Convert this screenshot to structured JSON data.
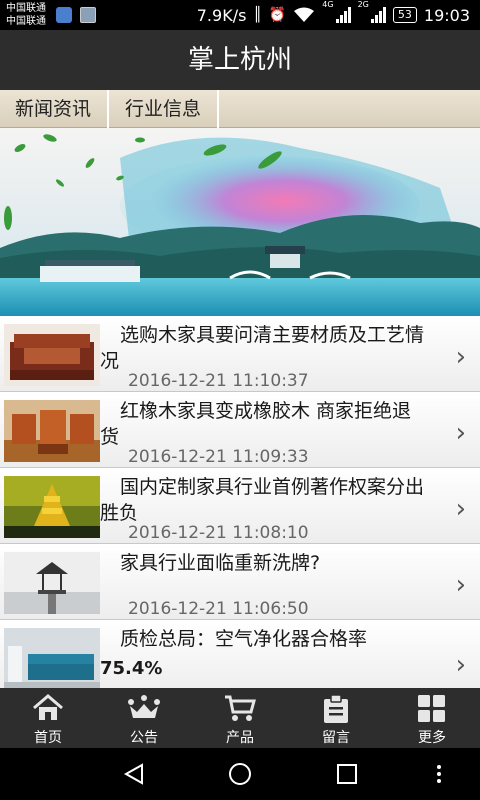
{
  "status_bar": {
    "carrier_1": "中国联通",
    "carrier_2": "中国联通",
    "speed": "7.9K/s",
    "net_1": "4G",
    "net_2": "2G",
    "battery": "53",
    "time": "19:03"
  },
  "header": {
    "title": "掌上杭州"
  },
  "tabs": [
    {
      "label": "新闻资讯"
    },
    {
      "label": "行业信息"
    }
  ],
  "news": [
    {
      "title": "选购木家具要问清主要材质及工艺情况",
      "date": "2016-12-21 11:10:37",
      "thumb": "bed-furniture"
    },
    {
      "title": "红橡木家具变成橡胶木 商家拒绝退货",
      "date": "2016-12-21 11:09:33",
      "thumb": "wood-sofa-set"
    },
    {
      "title": "国内定制家具行业首例著作权案分出胜负",
      "date": "2016-12-21 11:08:10",
      "thumb": "pagoda-night"
    },
    {
      "title": "家具行业面临重新洗牌?",
      "date": "2016-12-21 11:06:50",
      "thumb": "pavilion-lake"
    },
    {
      "title": "质检总局：空气净化器合格率",
      "extra": "75.4%",
      "thumb": "blue-sofa-room"
    }
  ],
  "bottom_nav": [
    {
      "label": "首页",
      "icon": "home-icon"
    },
    {
      "label": "公告",
      "icon": "crown-icon"
    },
    {
      "label": "产品",
      "icon": "cart-icon"
    },
    {
      "label": "留言",
      "icon": "clipboard-icon"
    },
    {
      "label": "更多",
      "icon": "grid-icon"
    }
  ],
  "colors": {
    "header_bg": "#2d2d2d",
    "tab_bg": "#e3dac8",
    "statusbar_bg": "#000000"
  }
}
